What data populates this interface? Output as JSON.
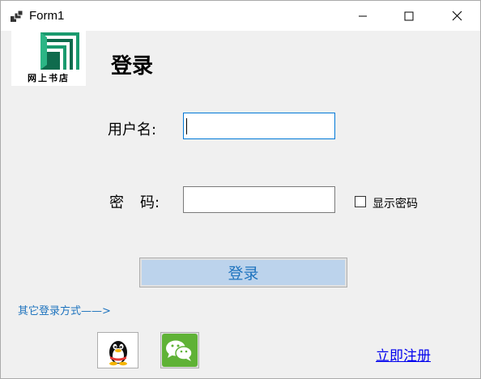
{
  "window": {
    "title": "Form1"
  },
  "logo": {
    "text": "网上书店",
    "colors": {
      "green": "#1a9a6e",
      "dark": "#0f6b4d"
    }
  },
  "form": {
    "heading": "登录",
    "username_label": "用户名:",
    "username_value": "",
    "password_label_a": "密",
    "password_label_b": "码:",
    "password_value": "",
    "show_password_label": "显示密码",
    "show_password_checked": false,
    "login_button_label": "登录"
  },
  "footer": {
    "other_login_text": "其它登录方式——>",
    "social_icons": [
      "qq-penguin-icon",
      "wechat-icon"
    ],
    "register_link": "立即注册"
  },
  "colors": {
    "accent": "#0078d7",
    "link": "#0000ee",
    "button_fill": "#bcd3ec",
    "button_text": "#1e73be"
  }
}
